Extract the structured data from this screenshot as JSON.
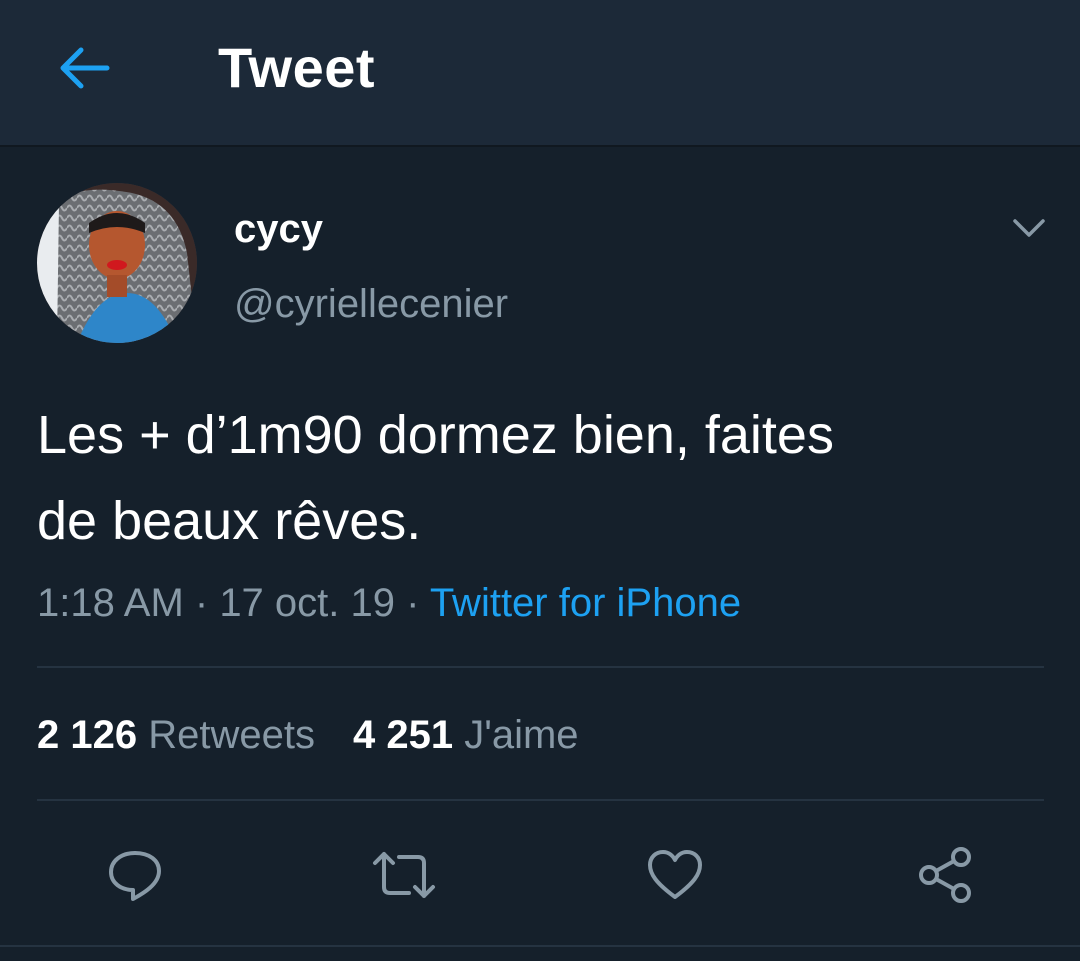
{
  "header": {
    "title": "Tweet",
    "back_icon": "arrow-left-icon",
    "accent_color": "#1da1f2"
  },
  "tweet": {
    "author": {
      "display_name": "cycy",
      "handle": "@cyriellecenier"
    },
    "text": "Les + d’1m90 dormez bien, faites\nde beaux rêves.",
    "time": "1:18 AM",
    "separator": " · ",
    "date": "17 oct. 19",
    "source": "Twitter for iPhone",
    "stats": {
      "retweets_count": "2 126",
      "retweets_label": "Retweets",
      "likes_count": "4 251",
      "likes_label": "J'aime"
    },
    "actions": {
      "reply_icon": "reply-icon",
      "retweet_icon": "retweet-icon",
      "like_icon": "heart-icon",
      "share_icon": "share-icon"
    }
  },
  "colors": {
    "background": "#15202b",
    "header_background": "#1c2938",
    "secondary_text": "#8899a6",
    "link": "#1da1f2"
  }
}
